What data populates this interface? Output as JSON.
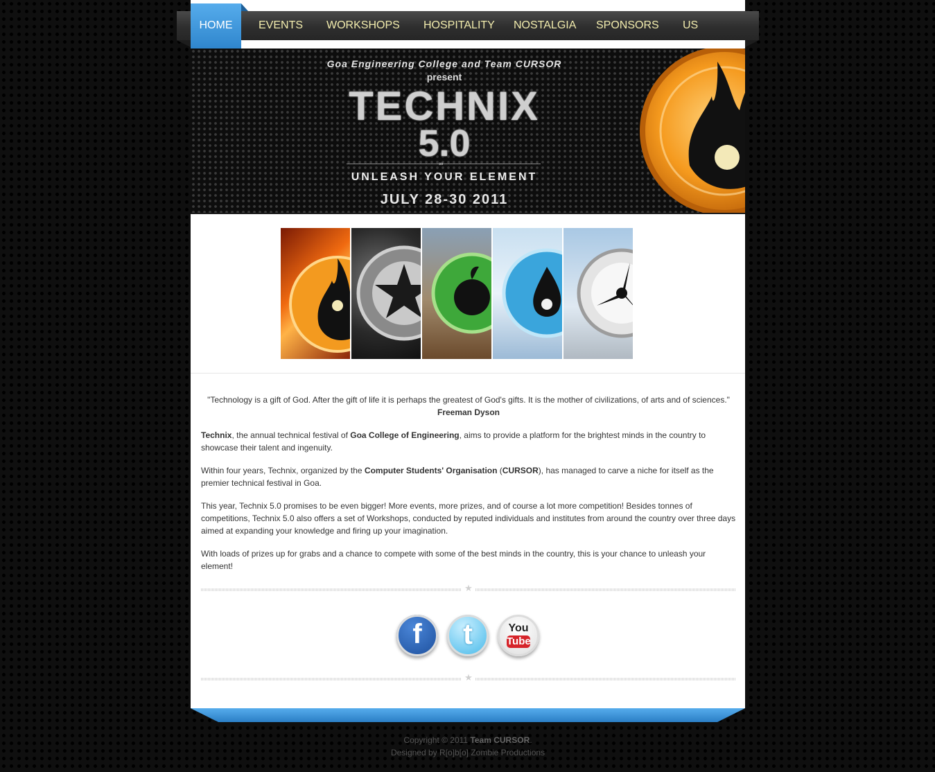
{
  "nav": {
    "items": [
      {
        "label": "HOME"
      },
      {
        "label": "EVENTS"
      },
      {
        "label": "WORKSHOPS"
      },
      {
        "label": "HOSPITALITY"
      },
      {
        "label": "NOSTALGIA"
      },
      {
        "label": "SPONSORS"
      },
      {
        "label": "US"
      }
    ],
    "active_index": 0,
    "accent": "#3b93dc"
  },
  "banner": {
    "presenter": "Goa Engineering College and Team CURSOR",
    "present": "present",
    "title": "TECHNIX",
    "version": "5.0",
    "tagline": "UNLEASH YOUR ELEMENT",
    "dates": "JULY 28-30 2011"
  },
  "elements": [
    "fire-emblem",
    "space-emblem",
    "earth-emblem",
    "water-emblem",
    "air-emblem"
  ],
  "quote": {
    "text": "\"Technology is a gift of God. After the gift of life it is perhaps the greatest of God's gifts. It is the mother of civilizations, of arts and of sciences.\"",
    "author": "Freeman Dyson"
  },
  "about": {
    "p1": {
      "a": "Technix",
      "b": ", the annual technical festival of ",
      "c": "Goa College of Engineering",
      "d": ", aims to provide a platform for the brightest minds in the country to showcase their talent and ingenuity."
    },
    "p2": {
      "a": "Within four years, Technix, organized by the ",
      "b": "Computer Students' Organisation",
      "c": " (",
      "d": "CURSOR",
      "e": "), has managed to carve a niche for itself as the premier technical festival in Goa."
    },
    "p3": "This year, Technix 5.0 promises to be even bigger! More events, more prizes, and of course a lot more competition! Besides tonnes of competitions, Technix 5.0 also offers a set of Workshops, conducted by reputed individuals and institutes from around the country over three days aimed at expanding your knowledge and firing up your imagination.",
    "p4": "With loads of prizes up for grabs and a chance to compete with some of the best minds in the country, this is your chance to unleash your element!"
  },
  "social": {
    "facebook": "f",
    "twitter": "t",
    "youtube_top": "You",
    "youtube_bottom": "Tube"
  },
  "footer": {
    "copyright_prefix": "Copyright © 2011 ",
    "copyright_team": "Team CURSOR",
    "copyright_suffix": ".",
    "designed": "Designed by R[o]b[o] Zombie Productions"
  }
}
